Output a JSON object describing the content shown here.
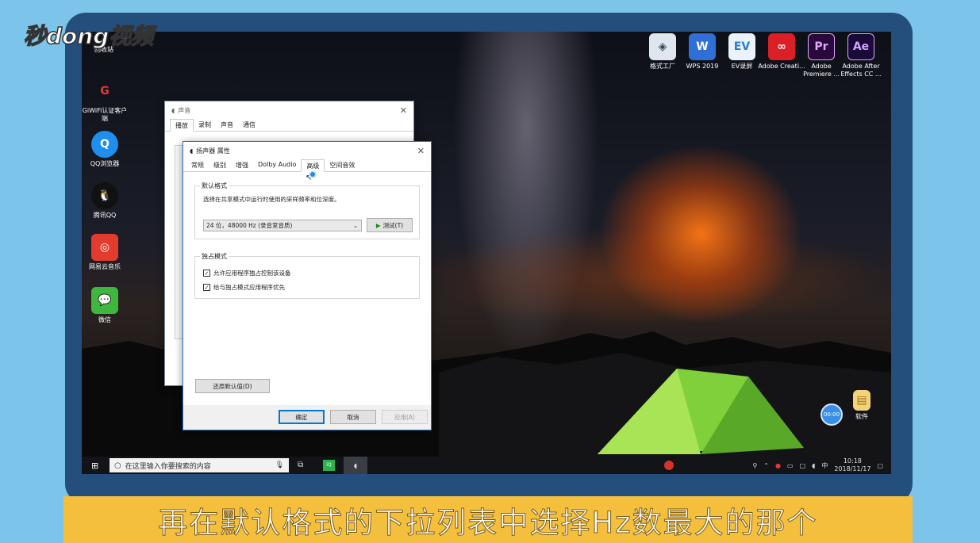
{
  "watermark": {
    "logo": "秒dong视频"
  },
  "desktop": {
    "left_icons": [
      {
        "label": "回收站"
      },
      {
        "label": "GiWiFi认证客户端"
      },
      {
        "label": "QQ浏览器"
      },
      {
        "label": "腾讯QQ"
      },
      {
        "label": "网易云音乐"
      },
      {
        "label": "微信"
      }
    ],
    "top_icons": [
      {
        "label": "格式工厂"
      },
      {
        "label": "WPS 2019"
      },
      {
        "label": "EV录屏"
      },
      {
        "label": "Adobe Creati..."
      },
      {
        "label": "Adobe Premiere ..."
      },
      {
        "label": "Adobe After Effects CC ..."
      }
    ],
    "folder_label": "软件",
    "timer_text": "00:00"
  },
  "sound_window": {
    "title": "声音",
    "tabs": [
      "播放",
      "录制",
      "声音",
      "通信"
    ]
  },
  "props_window": {
    "title": "扬声器 属性",
    "tabs": [
      "常规",
      "级别",
      "增强",
      "Dolby Audio",
      "高级",
      "空间音效"
    ],
    "active_tab": "高级",
    "default_format": {
      "group_label": "默认格式",
      "description": "选择在共享模式中运行时使用的采样频率和位深度。",
      "selected": "24 位，48000 Hz (录音室音质)",
      "test_button": "测试(T)"
    },
    "exclusive_mode": {
      "group_label": "独占模式",
      "option1": "允许应用程序独占控制该设备",
      "option2": "给与独占模式应用程序优先",
      "option1_checked": true,
      "option2_checked": true
    },
    "restore_button": "还原默认值(D)",
    "ok_button": "确定",
    "cancel_button": "取消",
    "apply_button": "应用(A)"
  },
  "taskbar": {
    "search_placeholder": "在这里输入你要搜索的内容",
    "time": "10:18",
    "date": "2018/11/17",
    "ime": "中"
  },
  "subtitle": "再在默认格式的下拉列表中选择Hz数最大的那个"
}
